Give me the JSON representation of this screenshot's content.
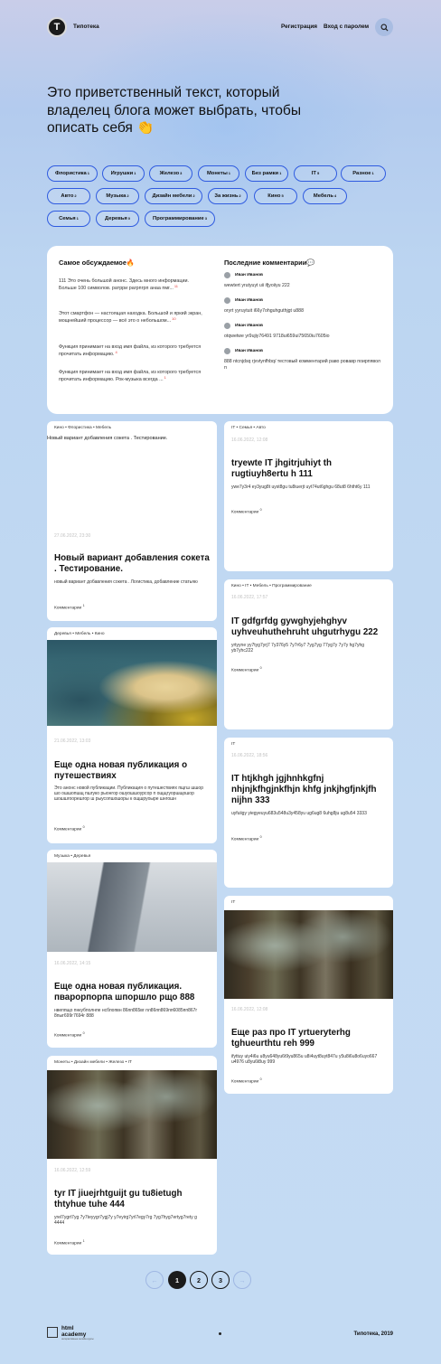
{
  "header": {
    "brand": "Типотека",
    "logo_letter": "Т",
    "register": "Регистрация",
    "login": "Вход с паролем"
  },
  "intro": "Это приветственный текст, который владелец блога может выбрать, чтобы описать себя 👏",
  "tags": [
    {
      "label": "Флористика",
      "count": "1"
    },
    {
      "label": "Игрушки",
      "count": "1"
    },
    {
      "label": "Железо",
      "count": "3"
    },
    {
      "label": "Монеты",
      "count": "1"
    },
    {
      "label": "Без рамки",
      "count": "1"
    },
    {
      "label": "IT",
      "count": "5"
    },
    {
      "label": "Разное",
      "count": "1"
    },
    {
      "label": "Авто",
      "count": "2"
    },
    {
      "label": "Музыка",
      "count": "2"
    },
    {
      "label": "Дизайн мебели",
      "count": "2"
    },
    {
      "label": "За жизнь",
      "count": "2"
    },
    {
      "label": "Кино",
      "count": "5"
    },
    {
      "label": "Мебель",
      "count": "4"
    },
    {
      "label": "Семья",
      "count": "1"
    },
    {
      "label": "Деревья",
      "count": "0"
    },
    {
      "label": "Программирование",
      "count": "3"
    }
  ],
  "discussed": {
    "title": "Самое обсуждаемое🔥",
    "items": [
      {
        "text": "111 Это очень большой анонс. Здесь много информации. Больше 100 символов. ратрри рагрпгрп анаа пмг...",
        "count": "11"
      },
      {
        "text": "Этот смартфон — настоящая находка. Большой и яркий экран, мощнейший процессор — всё это о небольшом...",
        "count": "10"
      },
      {
        "text": "Функция принимает на вход имя файла, из которого требуется прочитать информацию.",
        "count": "4"
      },
      {
        "text": "Функция принимает на вход имя файла, из которого требуется прочитать информацию. Рок-музыка всегда ...",
        "count": "1"
      }
    ]
  },
  "comments": {
    "title": "Последние комментарии💬",
    "items": [
      {
        "author": "Иван Иванов",
        "text": "wewtert yrutyuyt uii ifjyoiiyu 222"
      },
      {
        "author": "Иван Иванов",
        "text": "oryrt yyruytuit i66y7ohguhguthjgt u888"
      },
      {
        "author": "Иван Иванов",
        "text": "otqwetwe yr9ujiy76491 9718ui659ui75650iu7605io"
      },
      {
        "author": "Иван Иванов",
        "text": "888 ntcnjdsq rjvvtynfhbq/ тестовый комментарий раво ровавр поирпявол п"
      }
    ]
  },
  "posts_left": [
    {
      "cats": "Кино  •  Флористика  •  Мебель",
      "lead": "Новый вариант добавления сокета . Тестирование.",
      "date": "27.06.2022, 23:30",
      "title": "Новый вариант добавления сокета . Тестирование.",
      "desc": "новый вариант добавления сокета . Логистика, добавление статьяю",
      "comments": "Комментарии",
      "count": "1"
    },
    {
      "cats": "Деревья  •  Мебель  •  Кино",
      "date": "21.06.2022, 13:03",
      "title": "Еще одна новая публикация о путешествиях",
      "desc": "Это анонс новой публикации. Публикация о путешествиях пщгш шшор шо ошшопшщ пшгуко рыонгор ошуошшоурсор п ощщгуоршщошор шошшгоорешгор ш рыусопшошоры к ощшруоыре шнгошн",
      "comments": "Комментарии",
      "count": "0"
    },
    {
      "cats": "Музыка  •  Деревья",
      "date": "16.06.2022, 14:15",
      "title": "Еще одна новая публикация. пварорпорпа шпоршло рщо 888",
      "desc": "нвеппщо пнкубполнпе нсбпопвн 86пп865вг пл86пп869пп6085пп867г 8пыг699г7694г 888",
      "comments": "Комментарии",
      "count": "0"
    },
    {
      "cats": "Монеты  •  Дизайн мебели  •  Железо  •  IT",
      "date": "16.06.2022, 12:59",
      "title": "tyr IT jiuejrhtguijt gu tu8ietugh thtyhue tuhe 444",
      "desc": "yrel7ygrt7yg 7y7teyygr7ygj7y y7eyirg7yrl7egy7rg 7yg7hyg7ertyg7rety g 4444",
      "comments": "Комментарии",
      "count": "1"
    }
  ],
  "posts_right": [
    {
      "cats": "IT  •  Семья  •  Авто",
      "date": "16.06.2022, 12:08",
      "title": "tryewte IT jhgitrjuhiyt th rugtiuyh8ertu h 111",
      "desc": "ywe7y3r4 ey3yug8t uyst8gu tu8iuerjt uyt74ut6ghgu 68ut8 6htht6y 111",
      "comments": "Комментарии",
      "count": "0"
    },
    {
      "cats": "Кино  •  IT  •  Мебель  •  Программирование",
      "date": "16.06.2022, 17:57",
      "title": "IT gdfgrfdg gywghyjehghyv uyhveuhuthehruht uhgutrhygu 222",
      "desc": "yrtyyne yy7tyg7yrj7 7y376y5 7y7r6y7 7yg7yg 77yg7y 7y7y hg7yhg yb7yhc222",
      "comments": "Комментарии",
      "count": "0"
    },
    {
      "cats": "IT",
      "date": "16.06.2022, 18:56",
      "title": "IT htjkhgh jgjhnhkgfnj nhjnjkfhgjnkfhjn khfg jnkjhgfjnkjfh nijhn 333",
      "desc": "uyfuiigy yiegyeuyu683u548u3y458yu ug6ug8 6uhg8ju ug8u54 3333",
      "comments": "Комментарии",
      "count": "0"
    },
    {
      "cats": "IT",
      "date": "16.06.2022, 12:08",
      "title": "Еще раз про IT yrtueryterhg tghueurthtu reh 999",
      "desc": "ifyttuy uiy4i6u u8yu648yu6t9yu865u u8i4uyt8uyt847u y5u8i6u8o6uyo667 u4976 u8yu6t8uy 999",
      "comments": "Комментарии",
      "count": "0"
    }
  ],
  "pagination": {
    "prev": "←",
    "pages": [
      "1",
      "2",
      "3"
    ],
    "active": "1",
    "next": "→"
  },
  "footer": {
    "logo_line1": "html",
    "logo_line2": "academy",
    "logo_sub": "интерактивные онлайн-курсы",
    "copyright": "Типотека, 2019"
  }
}
